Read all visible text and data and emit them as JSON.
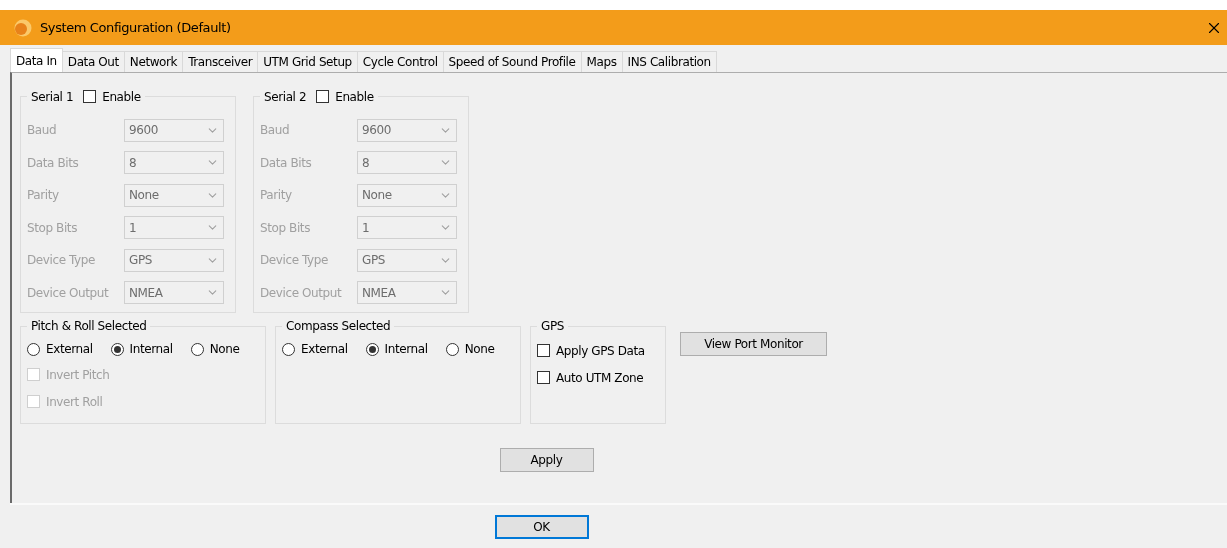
{
  "window": {
    "title": "System Configuration (Default)"
  },
  "tabs": [
    {
      "label": "Data In",
      "selected": true
    },
    {
      "label": "Data Out",
      "selected": false
    },
    {
      "label": "Network",
      "selected": false
    },
    {
      "label": "Transceiver",
      "selected": false
    },
    {
      "label": "UTM Grid Setup",
      "selected": false
    },
    {
      "label": "Cycle Control",
      "selected": false
    },
    {
      "label": "Speed of Sound Profile",
      "selected": false
    },
    {
      "label": "Maps",
      "selected": false
    },
    {
      "label": "INS Calibration",
      "selected": false
    }
  ],
  "serial_ports": [
    {
      "title": "Serial 1",
      "enable": {
        "label": "Enable",
        "checked": false
      },
      "disabled": true,
      "fields": [
        {
          "label": "Baud",
          "value": "9600"
        },
        {
          "label": "Data Bits",
          "value": "8"
        },
        {
          "label": "Parity",
          "value": "None"
        },
        {
          "label": "Stop Bits",
          "value": "1"
        },
        {
          "label": "Device Type",
          "value": "GPS"
        },
        {
          "label": "Device Output",
          "value": "NMEA"
        }
      ]
    },
    {
      "title": "Serial 2",
      "enable": {
        "label": "Enable",
        "checked": false
      },
      "disabled": true,
      "fields": [
        {
          "label": "Baud",
          "value": "9600"
        },
        {
          "label": "Data Bits",
          "value": "8"
        },
        {
          "label": "Parity",
          "value": "None"
        },
        {
          "label": "Stop Bits",
          "value": "1"
        },
        {
          "label": "Device Type",
          "value": "GPS"
        },
        {
          "label": "Device Output",
          "value": "NMEA"
        }
      ]
    }
  ],
  "pitch_roll": {
    "title": "Pitch & Roll Selected",
    "options": [
      {
        "label": "External",
        "selected": false
      },
      {
        "label": "Internal",
        "selected": true
      },
      {
        "label": "None",
        "selected": false
      }
    ],
    "checks": [
      {
        "label": "Invert Pitch",
        "checked": false,
        "disabled": true
      },
      {
        "label": "Invert Roll",
        "checked": false,
        "disabled": true
      }
    ]
  },
  "compass": {
    "title": "Compass Selected",
    "options": [
      {
        "label": "External",
        "selected": false
      },
      {
        "label": "Internal",
        "selected": true
      },
      {
        "label": "None",
        "selected": false
      }
    ]
  },
  "gps": {
    "title": "GPS",
    "checks": [
      {
        "label": "Apply GPS Data",
        "checked": false,
        "disabled": false
      },
      {
        "label": "Auto UTM Zone",
        "checked": false,
        "disabled": false
      }
    ]
  },
  "view_port_monitor_button": "View Port Monitor",
  "apply_button": "Apply",
  "ok_button": "OK"
}
